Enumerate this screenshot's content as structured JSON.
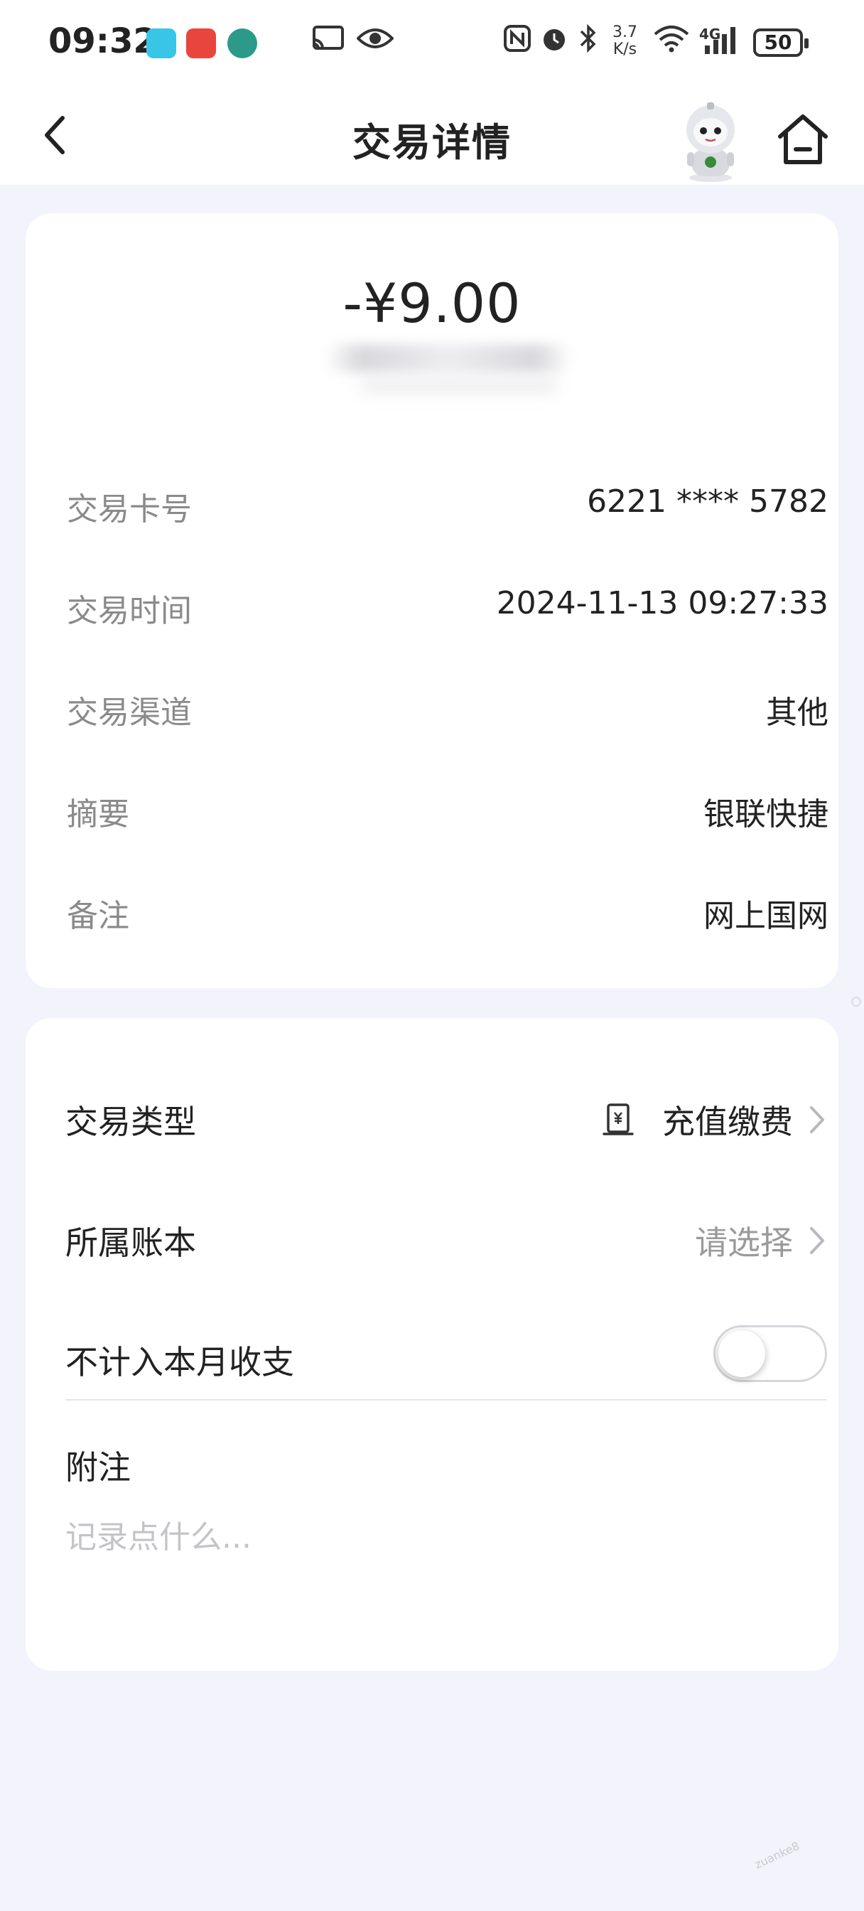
{
  "status_bar": {
    "time": "09:32",
    "speed_top": "3.7",
    "speed_bottom": "K/s",
    "network": "4G",
    "battery": "50"
  },
  "nav": {
    "title": "交易详情",
    "back_icon": "chevron-left-icon",
    "assistant_icon": "robot-avatar",
    "home_icon": "home-icon"
  },
  "transaction": {
    "amount": "-¥9.00",
    "rows": [
      {
        "label": "交易卡号",
        "value": "6221 **** 5782"
      },
      {
        "label": "交易时间",
        "value": "2024-11-13 09:27:33"
      },
      {
        "label": "交易渠道",
        "value": "其他"
      },
      {
        "label": "摘要",
        "value": "银联快捷"
      },
      {
        "label": "备注",
        "value": "网上国网"
      }
    ]
  },
  "settings": {
    "type_label": "交易类型",
    "type_value": "充值缴费",
    "ledger_label": "所属账本",
    "ledger_value": "请选择",
    "exclude_label": "不计入本月收支",
    "exclude_enabled": false,
    "note_label": "附注",
    "note_placeholder": "记录点什么...",
    "note_value": ""
  },
  "colors": {
    "page_bg": "#f3f3fb",
    "card_bg": "#ffffff",
    "label_gray": "#8a8a8a",
    "text_dark": "#222222",
    "placeholder": "#c4c4c8"
  }
}
